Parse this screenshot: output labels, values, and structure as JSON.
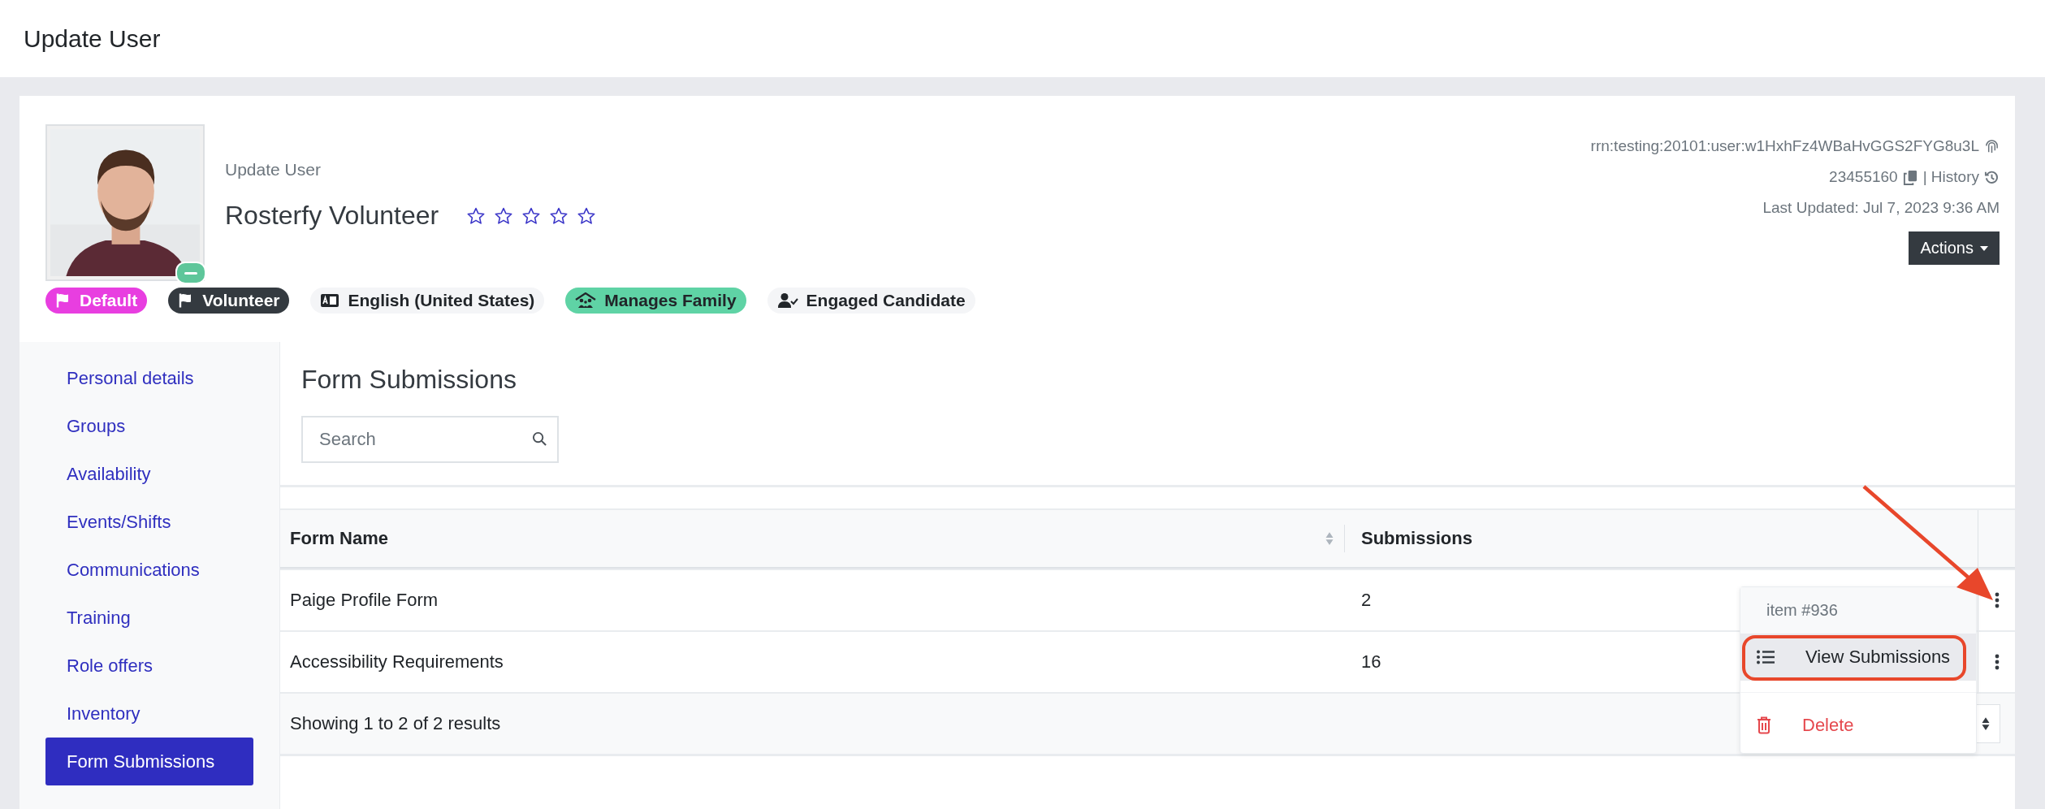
{
  "page_title": "Update User",
  "profile": {
    "subtitle": "Update User",
    "name": "Rosterfy Volunteer",
    "stars": 0,
    "status_online": true,
    "badges": [
      {
        "label": "Default",
        "color": "#e83ee0",
        "kind": "flag"
      },
      {
        "label": "Volunteer",
        "color": "#343a40",
        "kind": "flag"
      },
      {
        "label": "English (United States)",
        "color": "#f4f5f7",
        "kind": "language"
      },
      {
        "label": "Manages Family",
        "color": "#5fd3a5",
        "kind": "family"
      },
      {
        "label": "Engaged Candidate",
        "color": "#f4f5f7",
        "kind": "candidate"
      }
    ],
    "rrn": "rrn:testing:20101:user:w1HxhFz4WBaHvGGS2FYG8u3L",
    "id": "23455160",
    "history": "| History",
    "last_updated": "Last Updated: Jul 7, 2023 9:36 AM",
    "actions": "Actions"
  },
  "sidebar": {
    "items": [
      {
        "label": "Personal details",
        "selected": false
      },
      {
        "label": "Groups",
        "selected": false
      },
      {
        "label": "Availability",
        "selected": false
      },
      {
        "label": "Events/Shifts",
        "selected": false
      },
      {
        "label": "Communications",
        "selected": false
      },
      {
        "label": "Training",
        "selected": false
      },
      {
        "label": "Role offers",
        "selected": false
      },
      {
        "label": "Inventory",
        "selected": false
      },
      {
        "label": "Form Submissions",
        "selected": true
      }
    ]
  },
  "content": {
    "title": "Form Submissions",
    "search": {
      "placeholder": "Search"
    },
    "table": {
      "columns": [
        "Form Name",
        "Submissions"
      ],
      "rows": [
        [
          "Paige Profile Form",
          "2"
        ],
        [
          "Accessibility Requirements",
          "16"
        ]
      ],
      "footer": "Showing 1 to 2 of 2 results"
    },
    "row_menu": {
      "header": "item #936",
      "items": [
        {
          "label": "View Submissions",
          "kind": "list",
          "selected": true,
          "circled": true
        },
        {
          "label": "Delete",
          "kind": "delete",
          "selected": false,
          "circled": false
        }
      ]
    },
    "pointer_arrow": true
  }
}
